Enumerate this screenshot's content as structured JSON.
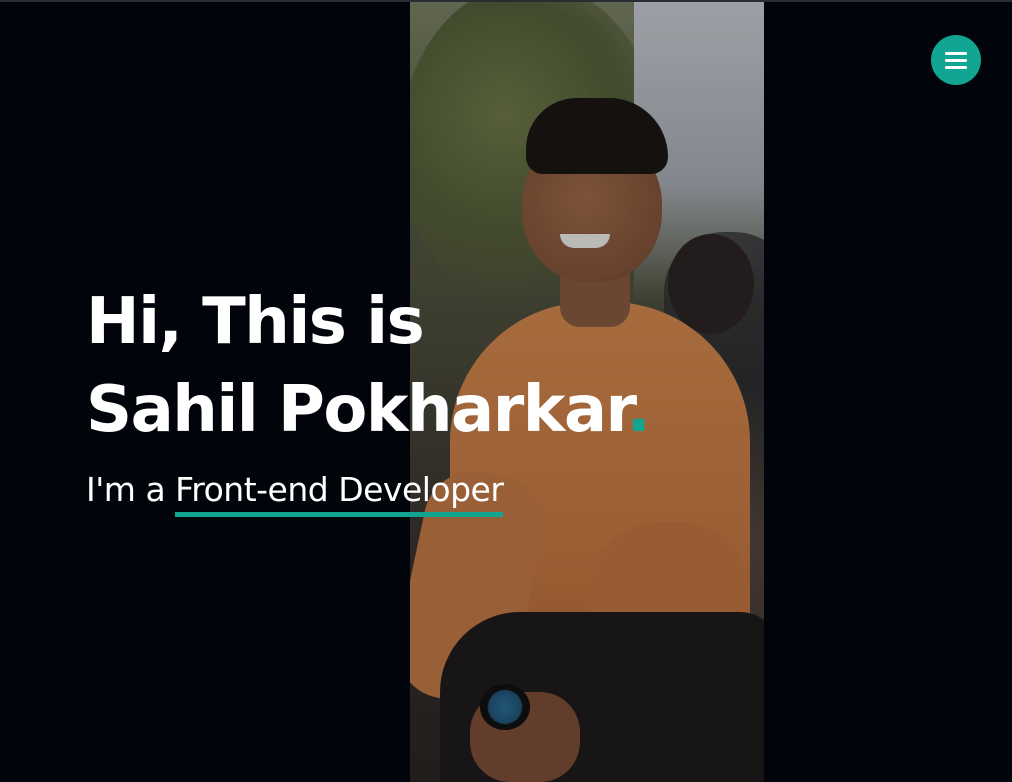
{
  "header": {
    "menu_icon": "hamburger-menu-icon",
    "accent_color": "#12a592"
  },
  "hero": {
    "greeting_line": "Hi, This is",
    "name": "Sahil Pokharkar",
    "name_dot": ".",
    "subtitle_prefix": "I'm a",
    "role": "Front-end Developer"
  },
  "photo": {
    "subject": "portrait-photo"
  }
}
